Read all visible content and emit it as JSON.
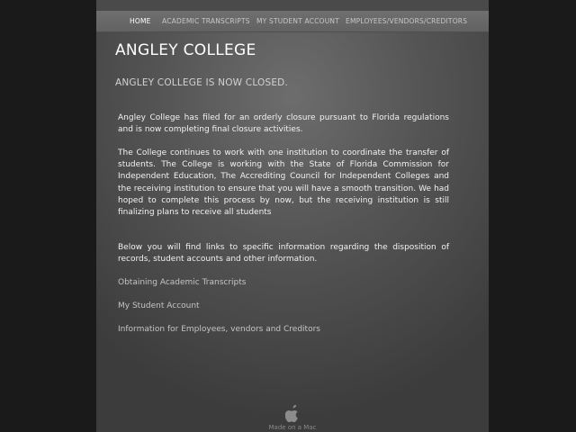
{
  "nav": {
    "items": [
      {
        "label": "HOME"
      },
      {
        "label": "ACADEMIC TRANSCRIPTS"
      },
      {
        "label": "MY STUDENT ACCOUNT"
      },
      {
        "label": "EMPLOYEES/VENDORS/CREDITORS"
      }
    ],
    "active": "HOME"
  },
  "site_title": "ANGLEY COLLEGE",
  "closed_heading": "ANGLEY COLLEGE IS NOW CLOSED.",
  "paragraphs": [
    "Angley College has filed for an orderly closure pursuant to Florida regulations and is now completing final closure activities.",
    "The College continues to work with one institution to coordinate the transfer of students.  The College is working with the State of Florida Commission for Independent Education, The Accrediting Council for Independent Colleges and the receiving institution to ensure that you will have a smooth transition. We had hoped to complete this process by now, but the receiving institution is still finalizing plans to receive all students",
    "Below you will find links to specific information regarding the disposition of records, student accounts and other information."
  ],
  "links": [
    {
      "label": "Obtaining Academic Transcripts"
    },
    {
      "label": "My Student Account"
    },
    {
      "label": "Information for Employees, vendors and Creditors"
    }
  ],
  "footer": {
    "text": "Made on a Mac",
    "icon": "apple-icon"
  },
  "colors": {
    "page_background": "#1a1a1a",
    "panel_background": "#555555",
    "navbar": "#686868",
    "text": "#f2f2f2",
    "link": "#c4c4c4"
  }
}
